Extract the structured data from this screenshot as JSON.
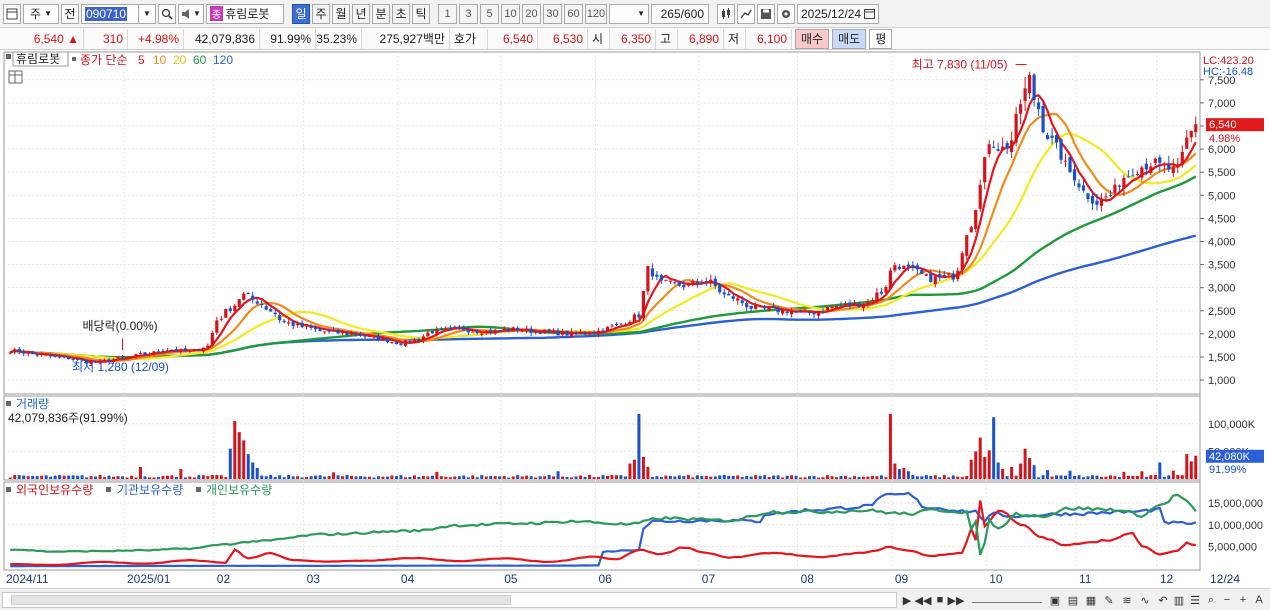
{
  "toolbar": {
    "market": "주",
    "prev_label": "전",
    "code": "090710",
    "name_badge": "종",
    "name": "휴림로봇",
    "periods": [
      "일",
      "주",
      "월",
      "년",
      "분",
      "초",
      "틱"
    ],
    "active_period": "일",
    "intervals": [
      "1",
      "3",
      "5",
      "10",
      "20",
      "30",
      "60",
      "120"
    ],
    "count": "265",
    "count_max": "/600",
    "date": "2025/12/24"
  },
  "quote": {
    "price": "6,540",
    "change_arrow": "▲",
    "change": "310",
    "change_pct": "+4.98%",
    "volume": "42,079,836",
    "volume_ratio": "91.99%",
    "turnover_ratio": "35.23%",
    "amount": "275,927백만",
    "hoga_label": "호가",
    "ask": "6,540",
    "bid": "6,530",
    "open_label": "시",
    "open": "6,350",
    "high_label": "고",
    "high": "6,890",
    "low_label": "저",
    "low": "6,100",
    "buy_label": "매수",
    "sell_label": "매도",
    "avg_label": "평"
  },
  "colors": {
    "up": "#d4141b",
    "down": "#1a50c8",
    "ma5": "#e8141b",
    "ma10": "#f08a1a",
    "ma20": "#f2ea1e",
    "ma60": "#1f9a3a",
    "ma120": "#2b5fd9",
    "foreign": "#2b5fd9",
    "institution": "#e8141b",
    "individual": "#2a9a5a"
  },
  "chart_data": [
    {
      "type": "candlestick",
      "legend_stock": "휴림로봇",
      "legend_series": "종가 단순",
      "series": [
        {
          "name": "5",
          "color": "#e8141b"
        },
        {
          "name": "10",
          "color": "#f08a1a"
        },
        {
          "name": "20",
          "color": "#f2ea1e"
        },
        {
          "name": "60",
          "color": "#1f9a3a"
        },
        {
          "name": "120",
          "color": "#2b5fd9"
        }
      ],
      "y_ticks": [
        "7,500",
        "7,000",
        "6,500",
        "6,000",
        "5,500",
        "5,000",
        "4,500",
        "4,000",
        "3,500",
        "3,000",
        "2,500",
        "2,000",
        "1,500",
        "1,000"
      ],
      "ylim": [
        850,
        7950
      ],
      "x_labels": [
        "2024/11",
        "2025/01",
        "02",
        "03",
        "04",
        "05",
        "06",
        "07",
        "08",
        "09",
        "10",
        "11",
        "12",
        "12/24"
      ],
      "lc": "LC:423.20",
      "hc": "HC:-16.48",
      "current_price": "6,540",
      "current_pct": "4.98%",
      "annotations": {
        "high": "최고 7,830 (11/05)",
        "low": "최저 1,280 (12/09)",
        "dividend": "배당락(0.00%)"
      },
      "close_anchors": [
        [
          0,
          1640
        ],
        [
          6,
          1550
        ],
        [
          12,
          1480
        ],
        [
          18,
          1380
        ],
        [
          25,
          1470
        ],
        [
          30,
          1560
        ],
        [
          35,
          1660
        ],
        [
          40,
          1620
        ],
        [
          44,
          1740
        ],
        [
          46,
          2300
        ],
        [
          49,
          2550
        ],
        [
          52,
          2850
        ],
        [
          55,
          2700
        ],
        [
          58,
          2500
        ],
        [
          61,
          2250
        ],
        [
          65,
          2150
        ],
        [
          70,
          2050
        ],
        [
          76,
          2000
        ],
        [
          82,
          1900
        ],
        [
          87,
          1800
        ],
        [
          90,
          1850
        ],
        [
          94,
          2050
        ],
        [
          100,
          2100
        ],
        [
          106,
          2050
        ],
        [
          112,
          2100
        ],
        [
          118,
          2050
        ],
        [
          124,
          2000
        ],
        [
          130,
          2050
        ],
        [
          136,
          2200
        ],
        [
          140,
          2400
        ],
        [
          142,
          3400
        ],
        [
          145,
          3100
        ],
        [
          150,
          3050
        ],
        [
          155,
          3150
        ],
        [
          160,
          2800
        ],
        [
          166,
          2550
        ],
        [
          172,
          2500
        ],
        [
          178,
          2450
        ],
        [
          184,
          2600
        ],
        [
          190,
          2650
        ],
        [
          194,
          2900
        ],
        [
          197,
          3500
        ],
        [
          200,
          3400
        ],
        [
          205,
          3200
        ],
        [
          210,
          3250
        ],
        [
          214,
          4400
        ],
        [
          216,
          5200
        ],
        [
          218,
          6200
        ],
        [
          221,
          6000
        ],
        [
          223,
          6200
        ],
        [
          225,
          7000
        ],
        [
          227,
          7500
        ],
        [
          228,
          7100
        ],
        [
          231,
          6300
        ],
        [
          233,
          6000
        ],
        [
          236,
          5500
        ],
        [
          240,
          5000
        ],
        [
          242,
          4850
        ],
        [
          245,
          5000
        ],
        [
          248,
          5400
        ],
        [
          251,
          5600
        ],
        [
          254,
          5700
        ],
        [
          257,
          5600
        ],
        [
          260,
          5500
        ],
        [
          262,
          6200
        ],
        [
          264,
          6540
        ]
      ]
    },
    {
      "type": "bar",
      "title": "거래량",
      "summary": "42,079,836주(91.99%)",
      "y_ticks": [
        "100,000K",
        "50,000K"
      ],
      "current": "42,080K",
      "current_pct": "91.99%",
      "ylim": [
        0,
        145000
      ],
      "baseline_k": 5000,
      "spikes_k": [
        [
          49,
          55000
        ],
        [
          50,
          105000
        ],
        [
          51,
          85000
        ],
        [
          52,
          70000
        ],
        [
          53,
          45000
        ],
        [
          54,
          30000
        ],
        [
          55,
          20000
        ],
        [
          29,
          22000
        ],
        [
          38,
          18000
        ],
        [
          72,
          12000
        ],
        [
          95,
          13000
        ],
        [
          122,
          14000
        ],
        [
          138,
          28000
        ],
        [
          139,
          35000
        ],
        [
          140,
          118000
        ],
        [
          141,
          40000
        ],
        [
          142,
          22000
        ],
        [
          196,
          118000
        ],
        [
          197,
          28000
        ],
        [
          198,
          18000
        ],
        [
          199,
          20000
        ],
        [
          200,
          14000
        ],
        [
          214,
          35000
        ],
        [
          215,
          50000
        ],
        [
          216,
          75000
        ],
        [
          217,
          40000
        ],
        [
          218,
          52000
        ],
        [
          219,
          112000
        ],
        [
          220,
          30000
        ],
        [
          221,
          18000
        ],
        [
          223,
          22000
        ],
        [
          225,
          28000
        ],
        [
          226,
          55000
        ],
        [
          227,
          38000
        ],
        [
          228,
          25000
        ],
        [
          231,
          16000
        ],
        [
          236,
          15000
        ],
        [
          248,
          13000
        ],
        [
          252,
          14000
        ],
        [
          256,
          30000
        ],
        [
          259,
          15000
        ],
        [
          262,
          45000
        ],
        [
          263,
          32000
        ],
        [
          264,
          42080
        ]
      ]
    },
    {
      "type": "line",
      "series": [
        {
          "name": "외국인보유수량",
          "color": "#2b5fd9",
          "points": [
            [
              0,
              450000
            ],
            [
              60,
              500000
            ],
            [
              120,
              550000
            ],
            [
              131,
              600000
            ],
            [
              132,
              3800000
            ],
            [
              140,
              4200000
            ],
            [
              141,
              9200000
            ],
            [
              143,
              10800000
            ],
            [
              160,
              11000000
            ],
            [
              167,
              10800000
            ],
            [
              168,
              12500000
            ],
            [
              180,
              13500000
            ],
            [
              190,
              14200000
            ],
            [
              196,
              16800000
            ],
            [
              200,
              17000000
            ],
            [
              204,
              14000000
            ],
            [
              215,
              13000000
            ],
            [
              217,
              11000000
            ],
            [
              219,
              12500000
            ],
            [
              223,
              12000000
            ],
            [
              235,
              12500000
            ],
            [
              250,
              13000000
            ],
            [
              256,
              13500000
            ],
            [
              257,
              10500000
            ],
            [
              264,
              10300000
            ]
          ]
        },
        {
          "name": "기관보유수량",
          "color": "#e8141b",
          "points": [
            [
              0,
              900000
            ],
            [
              10,
              700000
            ],
            [
              20,
              1400000
            ],
            [
              30,
              1000000
            ],
            [
              40,
              1800000
            ],
            [
              48,
              1200000
            ],
            [
              50,
              4200000
            ],
            [
              53,
              2200000
            ],
            [
              58,
              3400000
            ],
            [
              63,
              1800000
            ],
            [
              70,
              1500000
            ],
            [
              80,
              1700000
            ],
            [
              90,
              2300000
            ],
            [
              100,
              1600000
            ],
            [
              110,
              2200000
            ],
            [
              120,
              1400000
            ],
            [
              130,
              2600000
            ],
            [
              135,
              2000000
            ],
            [
              140,
              4200000
            ],
            [
              145,
              3200000
            ],
            [
              150,
              4800000
            ],
            [
              155,
              3500000
            ],
            [
              160,
              2400000
            ],
            [
              170,
              3500000
            ],
            [
              180,
              2500000
            ],
            [
              190,
              3500000
            ],
            [
              196,
              4800000
            ],
            [
              200,
              4000000
            ],
            [
              205,
              2800000
            ],
            [
              212,
              3500000
            ],
            [
              214,
              9000000
            ],
            [
              215,
              6500000
            ],
            [
              216,
              15500000
            ],
            [
              217,
              9500000
            ],
            [
              218,
              11000000
            ],
            [
              220,
              13500000
            ],
            [
              225,
              10000000
            ],
            [
              230,
              7000000
            ],
            [
              235,
              5200000
            ],
            [
              240,
              6000000
            ],
            [
              245,
              6500000
            ],
            [
              250,
              8000000
            ],
            [
              252,
              5000000
            ],
            [
              256,
              3200000
            ],
            [
              260,
              4000000
            ],
            [
              262,
              5800000
            ],
            [
              264,
              5400000
            ]
          ]
        },
        {
          "name": "개인보유수량",
          "color": "#2a9a5a",
          "points": [
            [
              0,
              4300000
            ],
            [
              10,
              3800000
            ],
            [
              20,
              3900000
            ],
            [
              30,
              4100000
            ],
            [
              40,
              4500000
            ],
            [
              48,
              5500000
            ],
            [
              55,
              6200000
            ],
            [
              70,
              7800000
            ],
            [
              90,
              8600000
            ],
            [
              100,
              9900000
            ],
            [
              118,
              10400000
            ],
            [
              125,
              10800000
            ],
            [
              138,
              10100000
            ],
            [
              145,
              11500000
            ],
            [
              160,
              11000000
            ],
            [
              170,
              13000000
            ],
            [
              180,
              13000000
            ],
            [
              190,
              13300000
            ],
            [
              200,
              12500000
            ],
            [
              206,
              13400000
            ],
            [
              213,
              13000000
            ],
            [
              214,
              9000000
            ],
            [
              215,
              10500000
            ],
            [
              216,
              3000000
            ],
            [
              217,
              6000000
            ],
            [
              218,
              11000000
            ],
            [
              220,
              9000000
            ],
            [
              224,
              12500000
            ],
            [
              230,
              12000000
            ],
            [
              236,
              13800000
            ],
            [
              246,
              13500000
            ],
            [
              252,
              12200000
            ],
            [
              256,
              14500000
            ],
            [
              260,
              16800000
            ],
            [
              262,
              15500000
            ],
            [
              264,
              12800000
            ]
          ]
        }
      ],
      "y_ticks": [
        "15,000,000",
        "10,000,000",
        "5,000,000"
      ],
      "ylim": [
        0,
        18500000
      ]
    }
  ]
}
